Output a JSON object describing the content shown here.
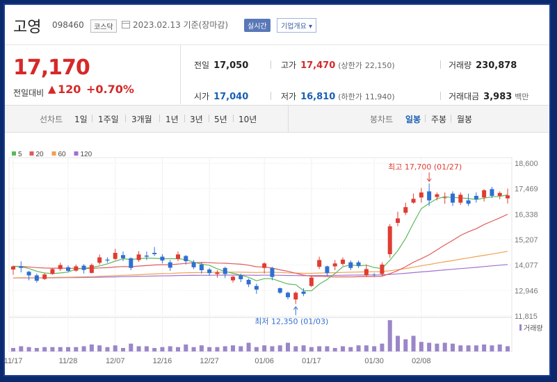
{
  "header": {
    "name": "고영",
    "code": "098460",
    "market": "코스닥",
    "date": "2023.02.13",
    "basis": "기준(장마감)",
    "realtime": "실시간",
    "profile": "기업개요 ▾"
  },
  "price": {
    "current": "17,170",
    "change_label": "전일대비",
    "change_arrow": "▲",
    "change": "120",
    "change_pct": "+0.70%"
  },
  "stats": {
    "prev_label": "전일",
    "prev": "17,050",
    "high_label": "고가",
    "high": "17,470",
    "upper_label": "(상한가",
    "upper": "22,150)",
    "volume_label": "거래량",
    "volume": "230,878",
    "open_label": "시가",
    "open": "17,040",
    "low_label": "저가",
    "low": "16,810",
    "lower_label": "(하한가",
    "lower": "11,940)",
    "amount_label": "거래대금",
    "amount": "3,983",
    "amount_unit": "백만"
  },
  "tabs": {
    "line_label": "선차트",
    "periods": [
      "1일",
      "1주일",
      "3개월",
      "1년",
      "3년",
      "5년",
      "10년"
    ],
    "candle_label": "봉차트",
    "candles": [
      "일봉",
      "주봉",
      "월봉"
    ],
    "active_candle": "일봉"
  },
  "colors": {
    "up": "#e03c31",
    "down": "#2f6fd1",
    "ma5": "#5cb85c",
    "ma20": "#e05a5a",
    "ma60": "#f0a050",
    "ma120": "#a070d0",
    "volume": "#9b86c9"
  },
  "chart_data": {
    "type": "candlestick",
    "ylim": [
      11815,
      18600
    ],
    "yticks": [
      "18,600",
      "17,469",
      "16,338",
      "15,207",
      "14,077",
      "12,946",
      "11,815"
    ],
    "xticks": [
      "11/17",
      "11/28",
      "12/07",
      "12/16",
      "12/27",
      "01/06",
      "01/17",
      "01/30",
      "02/08"
    ],
    "xtick_index": [
      0,
      7,
      13,
      19,
      25,
      32,
      38,
      46,
      52
    ],
    "legend": [
      {
        "name": "5",
        "color": "#5cb85c"
      },
      {
        "name": "20",
        "color": "#e05a5a"
      },
      {
        "name": "60",
        "color": "#f0a050"
      },
      {
        "name": "120",
        "color": "#a070d0"
      }
    ],
    "volume_label": "거래량",
    "high_annotation": "최고 17,700 (01/27)",
    "low_annotation": "최저 12,350 (01/03)",
    "candles": [
      [
        13880,
        14020,
        13650,
        14060
      ],
      [
        14020,
        13950,
        13750,
        14240
      ],
      [
        13780,
        13620,
        13400,
        13820
      ],
      [
        13620,
        13380,
        13300,
        13700
      ],
      [
        13460,
        13660,
        13420,
        13720
      ],
      [
        13680,
        13900,
        13650,
        13950
      ],
      [
        13900,
        14080,
        13820,
        14180
      ],
      [
        13980,
        13820,
        13760,
        14060
      ],
      [
        13830,
        14020,
        13780,
        14100
      ],
      [
        14050,
        13860,
        13700,
        14120
      ],
      [
        13730,
        14080,
        13700,
        14150
      ],
      [
        14180,
        14420,
        14100,
        14550
      ],
      [
        14320,
        14280,
        14180,
        14420
      ],
      [
        14350,
        14620,
        14300,
        14800
      ],
      [
        14520,
        14380,
        14250,
        14680
      ],
      [
        14380,
        13950,
        13850,
        14420
      ],
      [
        14300,
        14550,
        14220,
        14700
      ],
      [
        14500,
        14450,
        14300,
        14680
      ],
      [
        14620,
        14560,
        14480,
        14880
      ],
      [
        14450,
        14280,
        14150,
        14560
      ],
      [
        14200,
        13960,
        13820,
        14300
      ],
      [
        14350,
        14550,
        14250,
        14680
      ],
      [
        14480,
        14250,
        14100,
        14520
      ],
      [
        14200,
        13980,
        13900,
        14300
      ],
      [
        14100,
        13850,
        13700,
        14200
      ],
      [
        13880,
        13720,
        13600,
        13950
      ],
      [
        13680,
        13750,
        13520,
        13850
      ],
      [
        13950,
        13680,
        13500,
        14000
      ],
      [
        13400,
        13560,
        13300,
        13600
      ],
      [
        13620,
        13450,
        13320,
        13700
      ],
      [
        13420,
        13220,
        13100,
        13480
      ],
      [
        13150,
        12990,
        12800,
        13250
      ],
      [
        13950,
        14150,
        13700,
        14200
      ],
      [
        13950,
        13550,
        13400,
        14000
      ],
      [
        13050,
        12850,
        12800,
        13080
      ],
      [
        12850,
        12650,
        12550,
        12900
      ],
      [
        12550,
        12850,
        12350,
        12900
      ],
      [
        12900,
        12800,
        12700,
        13050
      ],
      [
        13150,
        13520,
        13100,
        13600
      ],
      [
        14000,
        14300,
        13900,
        14450
      ],
      [
        14020,
        13720,
        13600,
        14050
      ],
      [
        14020,
        14150,
        13850,
        14300
      ],
      [
        14130,
        14320,
        14050,
        14420
      ],
      [
        14200,
        13950,
        13850,
        14280
      ],
      [
        14200,
        14050,
        13950,
        14280
      ],
      [
        13620,
        13900,
        13580,
        14100
      ],
      [
        13650,
        13620,
        13560,
        13720
      ],
      [
        13680,
        14100,
        13600,
        14200
      ],
      [
        14560,
        15800,
        14400,
        15900
      ],
      [
        15950,
        16150,
        15800,
        16450
      ],
      [
        16400,
        16650,
        16300,
        16850
      ],
      [
        16850,
        17020,
        16800,
        17250
      ],
      [
        17080,
        17300,
        16850,
        17500
      ],
      [
        17350,
        16950,
        16700,
        17700
      ],
      [
        17100,
        17220,
        16950,
        17300
      ],
      [
        17050,
        17080,
        16800,
        17300
      ],
      [
        17250,
        16850,
        16700,
        17350
      ],
      [
        16850,
        17200,
        16750,
        17300
      ],
      [
        16950,
        16800,
        16700,
        17250
      ],
      [
        17150,
        17000,
        16850,
        17300
      ],
      [
        17080,
        17400,
        16900,
        17450
      ],
      [
        17450,
        17150,
        17050,
        17550
      ],
      [
        17150,
        17280,
        17000,
        17350
      ],
      [
        17040,
        17170,
        16810,
        17470
      ]
    ],
    "volumes": [
      4,
      6,
      5,
      4,
      5,
      5,
      5,
      5,
      5,
      6,
      8,
      7,
      5,
      7,
      4,
      9,
      6,
      6,
      4,
      5,
      6,
      5,
      8,
      5,
      7,
      5,
      5,
      6,
      7,
      6,
      10,
      5,
      7,
      6,
      7,
      10,
      6,
      7,
      5,
      6,
      6,
      4,
      6,
      5,
      7,
      7,
      6,
      9,
      36,
      18,
      14,
      18,
      11,
      10,
      9,
      10,
      9,
      7,
      7,
      7,
      8,
      7,
      8,
      6
    ]
  }
}
